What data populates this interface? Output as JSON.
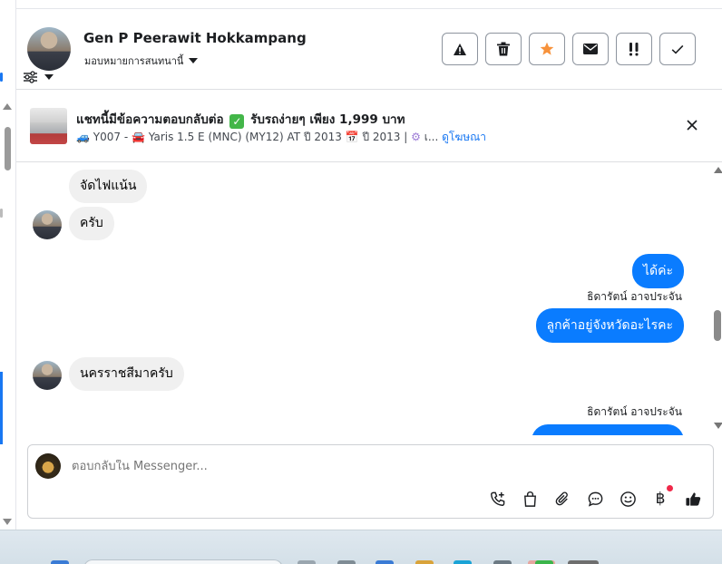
{
  "header": {
    "name": "Gen P Peerawit Hokkampang",
    "assign_label": "มอบหมายการสนทนานี้",
    "actions": [
      {
        "icon": "warning-icon"
      },
      {
        "icon": "trash-icon"
      },
      {
        "icon": "star-icon"
      },
      {
        "icon": "envelope-icon"
      },
      {
        "icon": "urgent-icon"
      },
      {
        "icon": "check-icon"
      }
    ]
  },
  "banner": {
    "title_before": "แชทนี้มีข้อความตอบกลับต่อ",
    "title_after": "รับรถง่ายๆ เพียง 1,999 บาท",
    "meta_code": "Y007 -",
    "meta_model": "Yaris 1.5 E (MNC) (MY12) AT ปี 2013",
    "meta_year": "ปี 2013 |",
    "meta_more": "เ...",
    "link": "ดูโฆษณา"
  },
  "messages": [
    {
      "from": "customer",
      "text": "จัดไฟแน้น"
    },
    {
      "from": "customer",
      "text": "ครับ"
    },
    {
      "from": "page",
      "text": "ได้ค่ะ"
    },
    {
      "from": "page",
      "sender": "ธิดารัตน์ อาจประจัน",
      "text": "ลูกค้าอยู่จังหวัดอะไรคะ"
    },
    {
      "from": "customer",
      "text": "นครราชสีมาครับ"
    },
    {
      "from": "page",
      "sender": "ธิดารัตน์ อาจประจัน",
      "text": ""
    }
  ],
  "composer": {
    "placeholder": "ตอบกลับใน Messenger...",
    "baht_symbol": "฿",
    "tools": [
      "call-add-icon",
      "bag-icon",
      "paperclip-icon",
      "chat-bubble-icon",
      "emoji-icon",
      "baht-icon",
      "thumbs-up-icon"
    ]
  },
  "colors": {
    "accent": "#0a7cff",
    "link": "#1877f2",
    "star": "#f7923b",
    "incoming_bubble": "#f0f0f0"
  }
}
